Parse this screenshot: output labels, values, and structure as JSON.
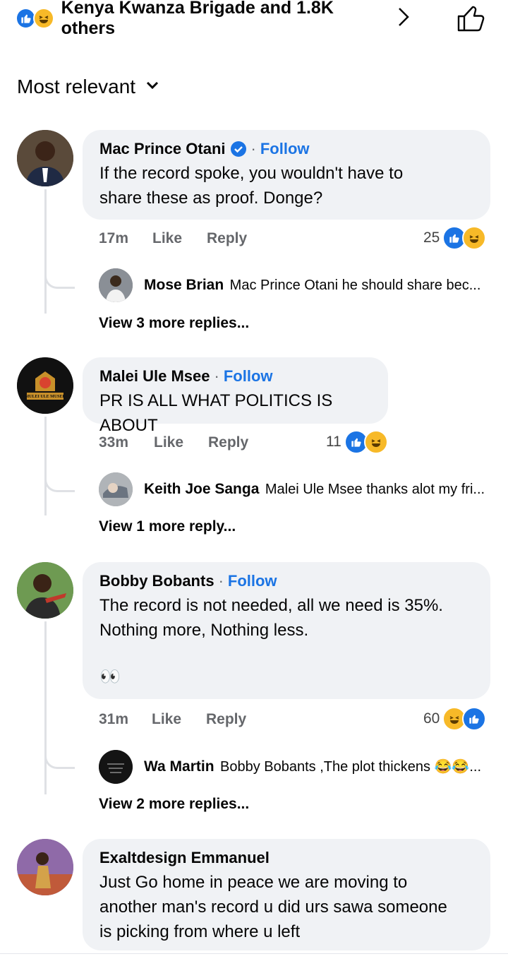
{
  "reactions_bar": {
    "summary": "Kenya Kwanza Brigade and 1.8K others",
    "icons": [
      "like-icon",
      "haha-icon"
    ]
  },
  "sort": {
    "label": "Most relevant"
  },
  "comments": [
    {
      "author": "Mac Prince Otani",
      "verified": true,
      "follow": "Follow",
      "text_lines": [
        "If the record spoke, you wouldn't have to",
        "share these as proof. Donge?"
      ],
      "time": "17m",
      "like": "Like",
      "reply": "Reply",
      "reaction_count": "25",
      "reply_preview": {
        "author": "Mose Brian",
        "text": "Mac Prince Otani he should share bec..."
      },
      "view_more": "View 3 more replies..."
    },
    {
      "author": "Malei Ule Msee",
      "avatar_text": "MULEI ULE MUSEE",
      "follow": "Follow",
      "text_lines": [
        "PR IS ALL WHAT POLITICS IS ABOUT"
      ],
      "time": "33m",
      "like": "Like",
      "reply": "Reply",
      "reaction_count": "11",
      "reply_preview": {
        "author": "Keith Joe Sanga",
        "text": "Malei Ule Msee thanks alot my fri..."
      },
      "view_more": "View 1 more reply..."
    },
    {
      "author": "Bobby Bobants",
      "follow": "Follow",
      "text_lines": [
        "The record is not needed, all we need is 35%.",
        "Nothing more, Nothing less."
      ],
      "emoji": "👀",
      "time": "31m",
      "like": "Like",
      "reply": "Reply",
      "reaction_count": "60",
      "reply_preview": {
        "author": "Wa Martin",
        "text": "Bobby Bobants ,The plot thickens 😂😂..."
      },
      "view_more": "View 2 more replies..."
    },
    {
      "author": "Exaltdesign Emmanuel",
      "text_lines": [
        "Just Go home in peace we are moving to",
        "another man's record u did urs sawa someone",
        "is picking from where u left"
      ]
    }
  ],
  "colors": {
    "accent": "#1b74e4",
    "bubble": "#f0f2f5",
    "muted": "#65676b",
    "haha": "#f7b928"
  }
}
